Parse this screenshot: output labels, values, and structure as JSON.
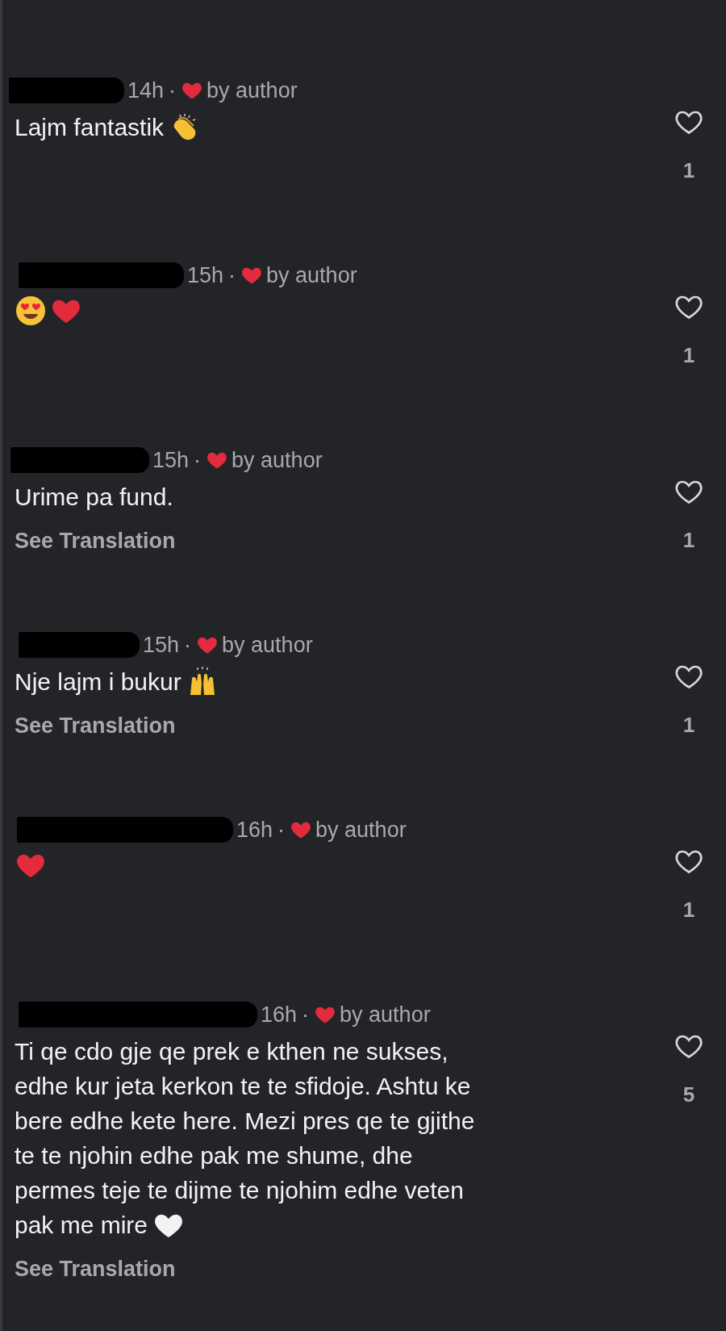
{
  "comments": [
    {
      "time": "14h",
      "separator": "·",
      "liked_by_author": true,
      "author_label": "by author",
      "lines": [
        "Lajm fantastik"
      ],
      "emojis": [
        {
          "kind": "clap"
        }
      ],
      "liked": false,
      "like_count": "1"
    },
    {
      "time": "15h",
      "separator": "·",
      "liked_by_author": true,
      "author_label": "by author",
      "emojis": [
        {
          "kind": "heart-eyes"
        },
        {
          "kind": "red-heart"
        }
      ],
      "liked": false,
      "like_count": "1"
    },
    {
      "time": "15h",
      "separator": "·",
      "liked_by_author": true,
      "author_label": "by author",
      "lines": [
        "Urime pa fund."
      ],
      "see_translation": "See Translation",
      "liked": false,
      "like_count": "1"
    },
    {
      "time": "15h",
      "separator": "·",
      "liked_by_author": true,
      "author_label": "by author",
      "lines": [
        "Nje lajm i bukur"
      ],
      "emojis": [
        {
          "kind": "raised-hands"
        }
      ],
      "see_translation": "See Translation",
      "liked": false,
      "like_count": "1"
    },
    {
      "time": "16h",
      "separator": "·",
      "liked_by_author": true,
      "author_label": "by author",
      "emojis": [
        {
          "kind": "red-heart"
        }
      ],
      "liked": false,
      "like_count": "1"
    },
    {
      "time": "16h",
      "separator": "·",
      "liked_by_author": true,
      "author_label": "by author",
      "lines": [
        "Ti qe cdo gje qe prek e kthen ne sukses,",
        "edhe kur jeta kerkon te te sfidoje. Ashtu ke",
        "bere edhe kete here. Mezi pres qe te gjithe",
        "te te njohin edhe pak me shume, dhe",
        "permes teje te dijme te njohim edhe veten",
        "pak me mire"
      ],
      "emojis": [
        {
          "kind": "white-heart"
        }
      ],
      "see_translation": "See Translation",
      "liked": false,
      "like_count": "5"
    }
  ]
}
